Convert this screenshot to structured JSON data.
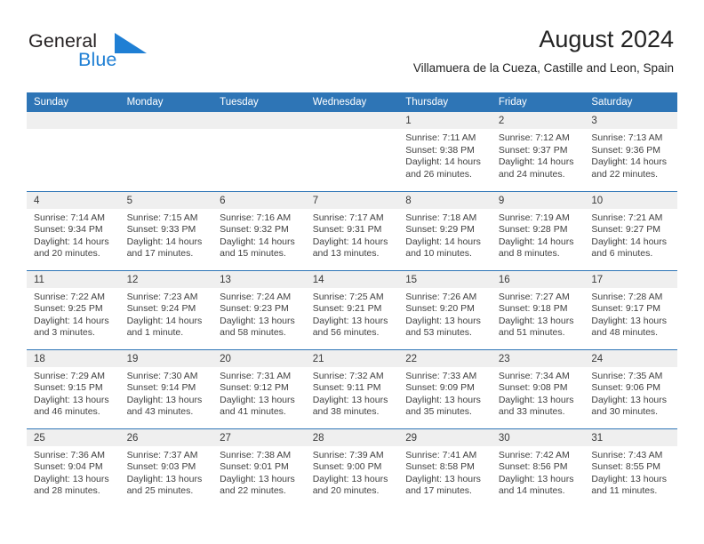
{
  "brand": {
    "word1": "General",
    "word2": "Blue",
    "logo_icon": "general-blue-triangle-logo",
    "blue": "#1f7fd4"
  },
  "header": {
    "title": "August 2024",
    "subtitle": "Villamuera de la Cueza, Castille and Leon, Spain"
  },
  "theme": {
    "header_blue": "#2e75b6",
    "daynum_bg": "#efefef",
    "text": "#404040"
  },
  "calendar": {
    "weekday_headers": [
      "Sunday",
      "Monday",
      "Tuesday",
      "Wednesday",
      "Thursday",
      "Friday",
      "Saturday"
    ],
    "weeks": [
      [
        {
          "day": "",
          "lines": []
        },
        {
          "day": "",
          "lines": []
        },
        {
          "day": "",
          "lines": []
        },
        {
          "day": "",
          "lines": []
        },
        {
          "day": "1",
          "lines": [
            "Sunrise: 7:11 AM",
            "Sunset: 9:38 PM",
            "Daylight: 14 hours",
            "and 26 minutes."
          ]
        },
        {
          "day": "2",
          "lines": [
            "Sunrise: 7:12 AM",
            "Sunset: 9:37 PM",
            "Daylight: 14 hours",
            "and 24 minutes."
          ]
        },
        {
          "day": "3",
          "lines": [
            "Sunrise: 7:13 AM",
            "Sunset: 9:36 PM",
            "Daylight: 14 hours",
            "and 22 minutes."
          ]
        }
      ],
      [
        {
          "day": "4",
          "lines": [
            "Sunrise: 7:14 AM",
            "Sunset: 9:34 PM",
            "Daylight: 14 hours",
            "and 20 minutes."
          ]
        },
        {
          "day": "5",
          "lines": [
            "Sunrise: 7:15 AM",
            "Sunset: 9:33 PM",
            "Daylight: 14 hours",
            "and 17 minutes."
          ]
        },
        {
          "day": "6",
          "lines": [
            "Sunrise: 7:16 AM",
            "Sunset: 9:32 PM",
            "Daylight: 14 hours",
            "and 15 minutes."
          ]
        },
        {
          "day": "7",
          "lines": [
            "Sunrise: 7:17 AM",
            "Sunset: 9:31 PM",
            "Daylight: 14 hours",
            "and 13 minutes."
          ]
        },
        {
          "day": "8",
          "lines": [
            "Sunrise: 7:18 AM",
            "Sunset: 9:29 PM",
            "Daylight: 14 hours",
            "and 10 minutes."
          ]
        },
        {
          "day": "9",
          "lines": [
            "Sunrise: 7:19 AM",
            "Sunset: 9:28 PM",
            "Daylight: 14 hours",
            "and 8 minutes."
          ]
        },
        {
          "day": "10",
          "lines": [
            "Sunrise: 7:21 AM",
            "Sunset: 9:27 PM",
            "Daylight: 14 hours",
            "and 6 minutes."
          ]
        }
      ],
      [
        {
          "day": "11",
          "lines": [
            "Sunrise: 7:22 AM",
            "Sunset: 9:25 PM",
            "Daylight: 14 hours",
            "and 3 minutes."
          ]
        },
        {
          "day": "12",
          "lines": [
            "Sunrise: 7:23 AM",
            "Sunset: 9:24 PM",
            "Daylight: 14 hours",
            "and 1 minute."
          ]
        },
        {
          "day": "13",
          "lines": [
            "Sunrise: 7:24 AM",
            "Sunset: 9:23 PM",
            "Daylight: 13 hours",
            "and 58 minutes."
          ]
        },
        {
          "day": "14",
          "lines": [
            "Sunrise: 7:25 AM",
            "Sunset: 9:21 PM",
            "Daylight: 13 hours",
            "and 56 minutes."
          ]
        },
        {
          "day": "15",
          "lines": [
            "Sunrise: 7:26 AM",
            "Sunset: 9:20 PM",
            "Daylight: 13 hours",
            "and 53 minutes."
          ]
        },
        {
          "day": "16",
          "lines": [
            "Sunrise: 7:27 AM",
            "Sunset: 9:18 PM",
            "Daylight: 13 hours",
            "and 51 minutes."
          ]
        },
        {
          "day": "17",
          "lines": [
            "Sunrise: 7:28 AM",
            "Sunset: 9:17 PM",
            "Daylight: 13 hours",
            "and 48 minutes."
          ]
        }
      ],
      [
        {
          "day": "18",
          "lines": [
            "Sunrise: 7:29 AM",
            "Sunset: 9:15 PM",
            "Daylight: 13 hours",
            "and 46 minutes."
          ]
        },
        {
          "day": "19",
          "lines": [
            "Sunrise: 7:30 AM",
            "Sunset: 9:14 PM",
            "Daylight: 13 hours",
            "and 43 minutes."
          ]
        },
        {
          "day": "20",
          "lines": [
            "Sunrise: 7:31 AM",
            "Sunset: 9:12 PM",
            "Daylight: 13 hours",
            "and 41 minutes."
          ]
        },
        {
          "day": "21",
          "lines": [
            "Sunrise: 7:32 AM",
            "Sunset: 9:11 PM",
            "Daylight: 13 hours",
            "and 38 minutes."
          ]
        },
        {
          "day": "22",
          "lines": [
            "Sunrise: 7:33 AM",
            "Sunset: 9:09 PM",
            "Daylight: 13 hours",
            "and 35 minutes."
          ]
        },
        {
          "day": "23",
          "lines": [
            "Sunrise: 7:34 AM",
            "Sunset: 9:08 PM",
            "Daylight: 13 hours",
            "and 33 minutes."
          ]
        },
        {
          "day": "24",
          "lines": [
            "Sunrise: 7:35 AM",
            "Sunset: 9:06 PM",
            "Daylight: 13 hours",
            "and 30 minutes."
          ]
        }
      ],
      [
        {
          "day": "25",
          "lines": [
            "Sunrise: 7:36 AM",
            "Sunset: 9:04 PM",
            "Daylight: 13 hours",
            "and 28 minutes."
          ]
        },
        {
          "day": "26",
          "lines": [
            "Sunrise: 7:37 AM",
            "Sunset: 9:03 PM",
            "Daylight: 13 hours",
            "and 25 minutes."
          ]
        },
        {
          "day": "27",
          "lines": [
            "Sunrise: 7:38 AM",
            "Sunset: 9:01 PM",
            "Daylight: 13 hours",
            "and 22 minutes."
          ]
        },
        {
          "day": "28",
          "lines": [
            "Sunrise: 7:39 AM",
            "Sunset: 9:00 PM",
            "Daylight: 13 hours",
            "and 20 minutes."
          ]
        },
        {
          "day": "29",
          "lines": [
            "Sunrise: 7:41 AM",
            "Sunset: 8:58 PM",
            "Daylight: 13 hours",
            "and 17 minutes."
          ]
        },
        {
          "day": "30",
          "lines": [
            "Sunrise: 7:42 AM",
            "Sunset: 8:56 PM",
            "Daylight: 13 hours",
            "and 14 minutes."
          ]
        },
        {
          "day": "31",
          "lines": [
            "Sunrise: 7:43 AM",
            "Sunset: 8:55 PM",
            "Daylight: 13 hours",
            "and 11 minutes."
          ]
        }
      ]
    ]
  }
}
